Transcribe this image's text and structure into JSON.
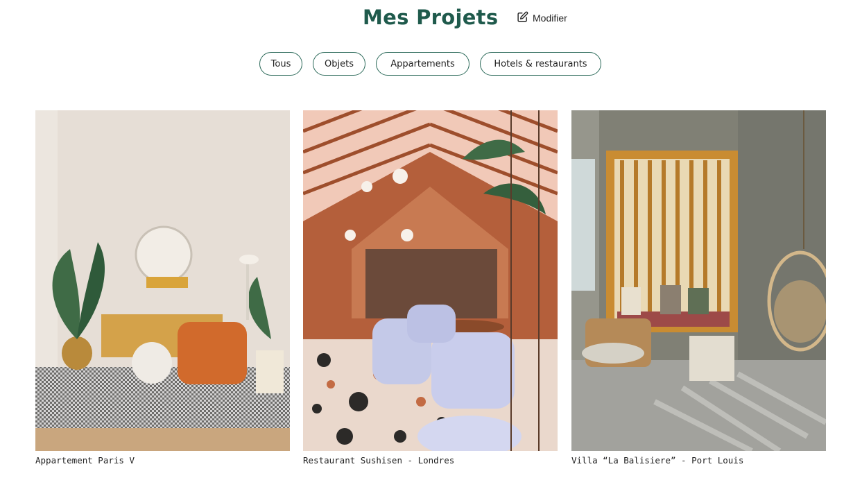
{
  "header": {
    "title": "Mes Projets",
    "edit_label": "Modifier",
    "edit_icon": "edit-icon"
  },
  "filters": [
    {
      "label": "Tous"
    },
    {
      "label": "Objets"
    },
    {
      "label": "Appartements"
    },
    {
      "label": "Hotels & restaurants"
    }
  ],
  "colors": {
    "brand_green": "#1f5a4c",
    "pill_border": "#2c6a5a"
  },
  "projects": [
    {
      "caption": "Appartement Paris V"
    },
    {
      "caption": "Restaurant Sushisen - Londres"
    },
    {
      "caption": "Villa “La Balisiere” - Port Louis"
    }
  ]
}
